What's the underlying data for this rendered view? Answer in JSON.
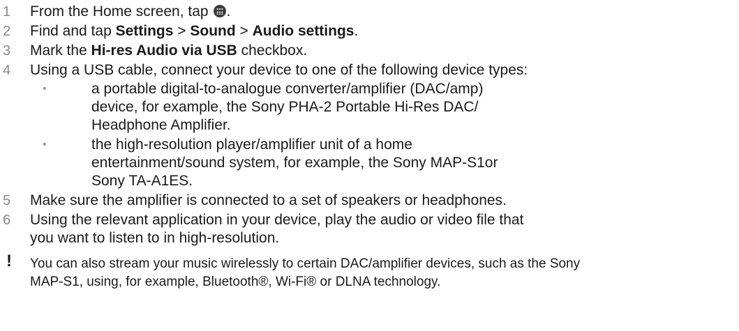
{
  "steps": [
    {
      "num": "1",
      "pre": "From the Home screen, tap ",
      "icon": "apps-grid-icon",
      "post": "."
    },
    {
      "num": "2",
      "pre": "Find and tap ",
      "b1": "Settings",
      "sep1": " > ",
      "b2": "Sound",
      "sep2": " > ",
      "b3": "Audio settings",
      "post": "."
    },
    {
      "num": "3",
      "pre": "Mark the ",
      "b1": "Hi-res Audio via USB",
      "post": " checkbox."
    },
    {
      "num": "4",
      "text": "Using a USB cable, connect your device to one of the following device types:"
    },
    {
      "num": "5",
      "text": "Make sure the amplifier is connected to a set of speakers or headphones."
    },
    {
      "num": "6",
      "lines": [
        "Using the relevant application in your device, play the audio or video file that",
        "you want to listen to in high-resolution."
      ]
    }
  ],
  "bullets": [
    {
      "marker": "•",
      "lines": [
        "a portable digital-to-analogue converter/amplifier (DAC/amp)",
        "device, for example, the Sony PHA-2 Portable Hi-Res DAC/",
        "Headphone Amplifier."
      ]
    },
    {
      "marker": "•",
      "lines": [
        "the high-resolution player/amplifier unit of a home",
        "entertainment/sound system, for example, the Sony MAP-S1or",
        "Sony TA-A1ES."
      ]
    }
  ],
  "note": {
    "icon": "exclamation-icon",
    "symbol": "!",
    "lines": [
      "You can also stream your music wirelessly to certain DAC/amplifier devices, such as the Sony",
      "MAP-S1, using, for example, Bluetooth®, Wi-Fi® or DLNA technology."
    ]
  }
}
